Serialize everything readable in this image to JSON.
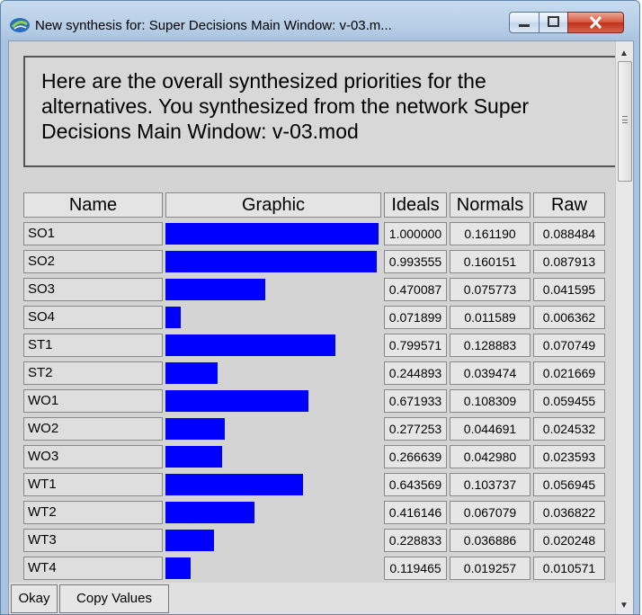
{
  "window": {
    "title": "New synthesis for: Super Decisions Main Window: v-03.m...",
    "controls": {
      "minimize": "—",
      "maximize": "☐",
      "close": "X"
    }
  },
  "header": {
    "text": "Here are the overall synthesized priorities for the alternatives.  You synthesized from the network Super Decisions Main Window: v-03.mod"
  },
  "table": {
    "columns": [
      "Name",
      "Graphic",
      "Ideals",
      "Normals",
      "Raw"
    ],
    "rows": [
      {
        "name": "SO1",
        "ideal": "1.000000",
        "normal": "0.161190",
        "raw": "0.088484",
        "bar": 1.0
      },
      {
        "name": "SO2",
        "ideal": "0.993555",
        "normal": "0.160151",
        "raw": "0.087913",
        "bar": 0.993555
      },
      {
        "name": "SO3",
        "ideal": "0.470087",
        "normal": "0.075773",
        "raw": "0.041595",
        "bar": 0.470087
      },
      {
        "name": "SO4",
        "ideal": "0.071899",
        "normal": "0.011589",
        "raw": "0.006362",
        "bar": 0.071899
      },
      {
        "name": "ST1",
        "ideal": "0.799571",
        "normal": "0.128883",
        "raw": "0.070749",
        "bar": 0.799571
      },
      {
        "name": "ST2",
        "ideal": "0.244893",
        "normal": "0.039474",
        "raw": "0.021669",
        "bar": 0.244893
      },
      {
        "name": "WO1",
        "ideal": "0.671933",
        "normal": "0.108309",
        "raw": "0.059455",
        "bar": 0.671933
      },
      {
        "name": "WO2",
        "ideal": "0.277253",
        "normal": "0.044691",
        "raw": "0.024532",
        "bar": 0.277253
      },
      {
        "name": "WO3",
        "ideal": "0.266639",
        "normal": "0.042980",
        "raw": "0.023593",
        "bar": 0.266639
      },
      {
        "name": "WT1",
        "ideal": "0.643569",
        "normal": "0.103737",
        "raw": "0.056945",
        "bar": 0.643569
      },
      {
        "name": "WT2",
        "ideal": "0.416146",
        "normal": "0.067079",
        "raw": "0.036822",
        "bar": 0.416146
      },
      {
        "name": "WT3",
        "ideal": "0.228833",
        "normal": "0.036886",
        "raw": "0.020248",
        "bar": 0.228833
      },
      {
        "name": "WT4",
        "ideal": "0.119465",
        "normal": "0.019257",
        "raw": "0.010571",
        "bar": 0.119465
      }
    ]
  },
  "footer": {
    "okay_label": "Okay",
    "copy_label": "Copy Values"
  },
  "colors": {
    "bar": "#0000ff",
    "panel": "#d4d4d4"
  }
}
